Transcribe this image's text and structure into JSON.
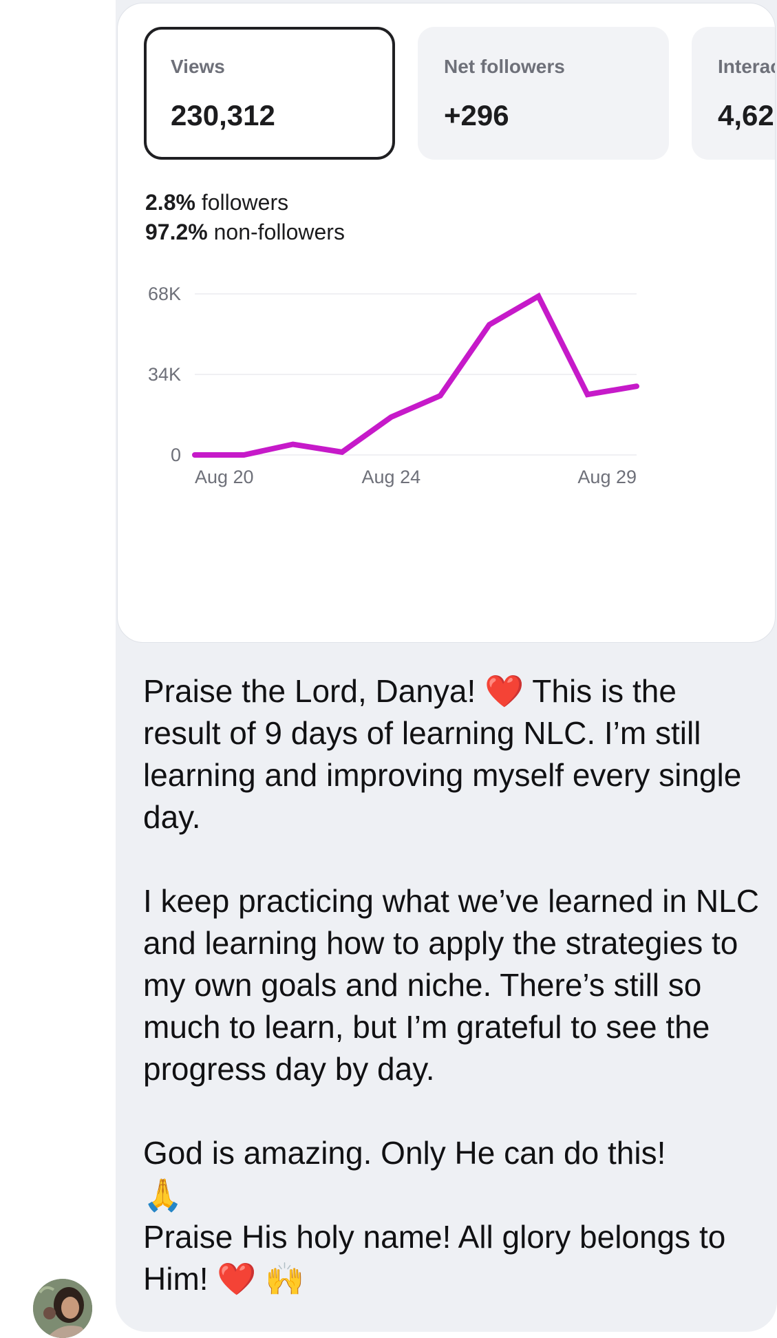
{
  "card": {
    "metrics": [
      {
        "label": "Views",
        "value": "230,312"
      },
      {
        "label": "Net followers",
        "value": "+296"
      },
      {
        "label": "Interac",
        "value": "4,62"
      }
    ],
    "breakdown": {
      "followers_pct": "2.8%",
      "followers_label": "followers",
      "nonfollowers_pct": "97.2%",
      "nonfollowers_label": "non-followers"
    }
  },
  "chart_data": {
    "type": "line",
    "color": "#c61ac9",
    "x": [
      "Aug 20",
      "Aug 21",
      "Aug 22",
      "Aug 23",
      "Aug 24",
      "Aug 25",
      "Aug 26",
      "Aug 27",
      "Aug 28",
      "Aug 29"
    ],
    "values": [
      0,
      0,
      4500,
      1200,
      16000,
      25000,
      55000,
      67000,
      25500,
      29000
    ],
    "y_ticks": [
      "0",
      "34K",
      "68K"
    ],
    "y_tick_values": [
      0,
      34000,
      68000
    ],
    "x_tick_labels": [
      "Aug 20",
      "Aug 24",
      "Aug 29"
    ],
    "ylim": [
      0,
      68000
    ],
    "grid": true
  },
  "message": {
    "paragraph1": "Praise the Lord, Danya! ❤️  This is the result of 9 days of learning NLC. I’m still learning and improving myself every single day.",
    "paragraph2": "I keep practicing what we’ve learned in NLC and learning how to apply the strategies to my own goals and niche. There’s still so much to learn, but I’m grateful to see the progress day by day.",
    "paragraph3": "God is amazing. Only He can do this!\n🙏\nPraise His holy name! All glory belongs to Him! ❤️ 🙌"
  },
  "sender": {
    "avatar_icon": "profile-avatar"
  }
}
